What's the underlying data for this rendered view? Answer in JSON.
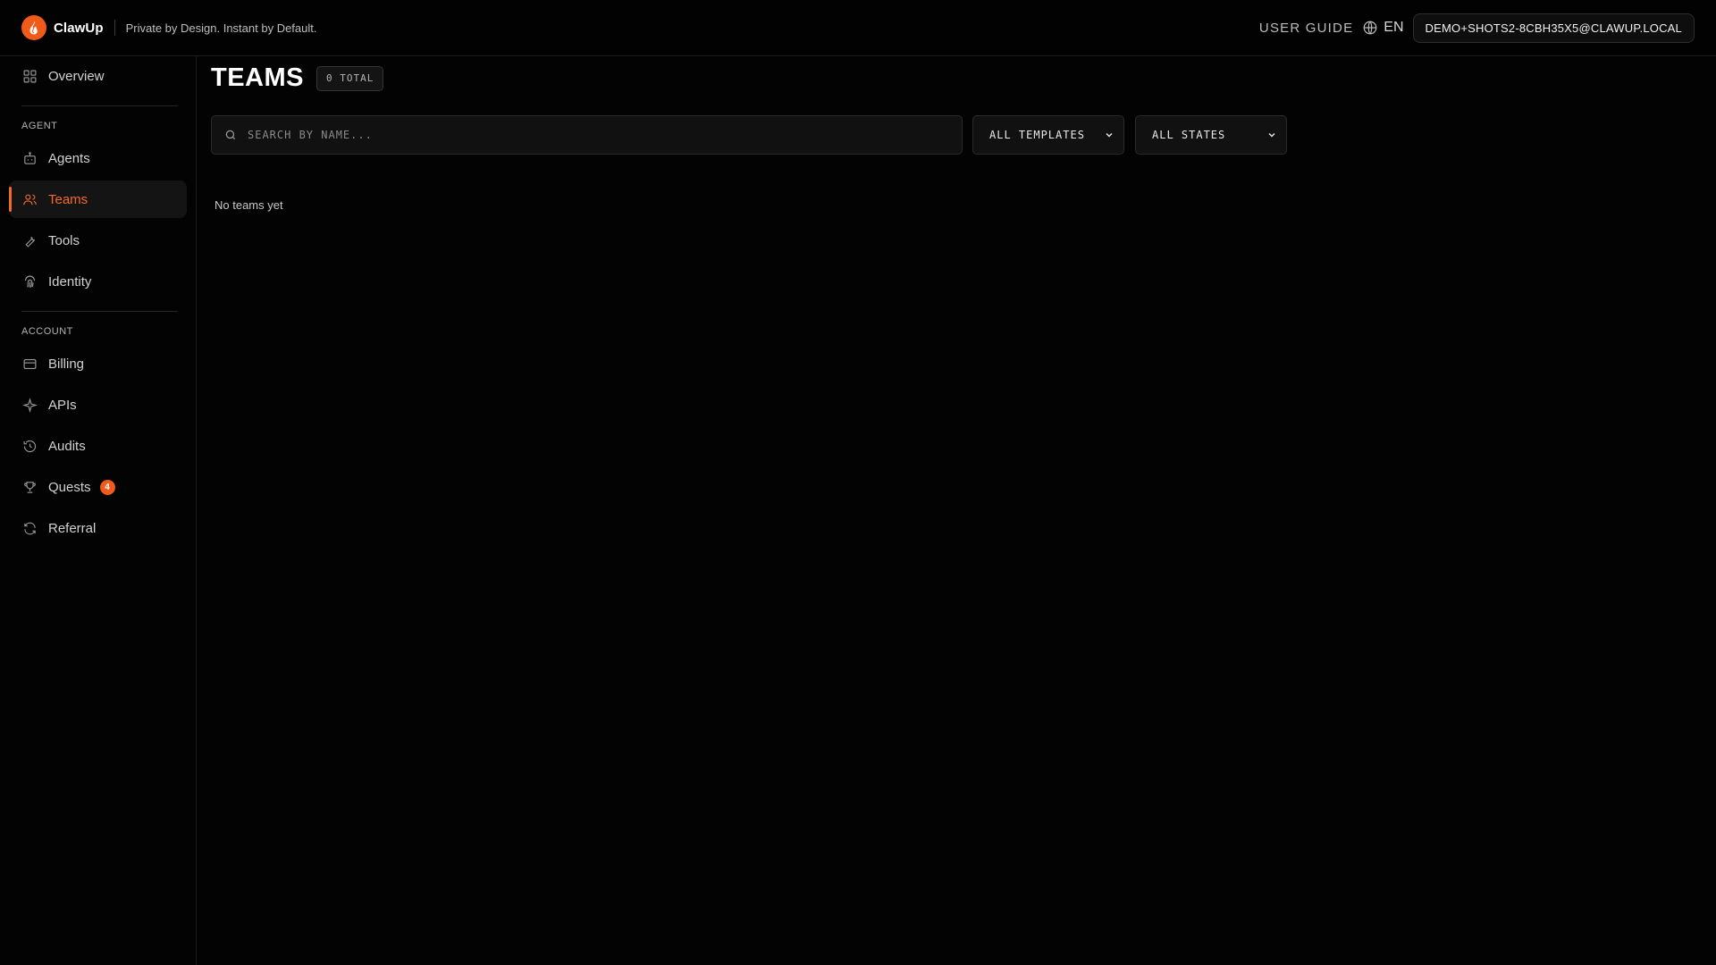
{
  "header": {
    "brand": "ClawUp",
    "tagline": "Private by Design. Instant by Default.",
    "user_guide": "USER GUIDE",
    "language": "EN",
    "account": "DEMO+SHOTS2-8CBH35X5@CLAWUP.LOCAL"
  },
  "sidebar": {
    "overview": "Overview",
    "agent_section": "AGENT",
    "agents": "Agents",
    "teams": "Teams",
    "tools": "Tools",
    "identity": "Identity",
    "account_section": "ACCOUNT",
    "billing": "Billing",
    "apis": "APIs",
    "audits": "Audits",
    "quests": "Quests",
    "quests_badge": "4",
    "referral": "Referral",
    "active_item": "Teams"
  },
  "main": {
    "title": "TEAMS",
    "count": "0 TOTAL",
    "search_placeholder": "SEARCH BY NAME...",
    "search_value": "",
    "template_filter": "ALL TEMPLATES",
    "state_filter": "ALL STATES",
    "empty_message": "No teams yet"
  },
  "colors": {
    "accent": "#f26a2b",
    "background": "#030303",
    "panel": "#111111"
  }
}
